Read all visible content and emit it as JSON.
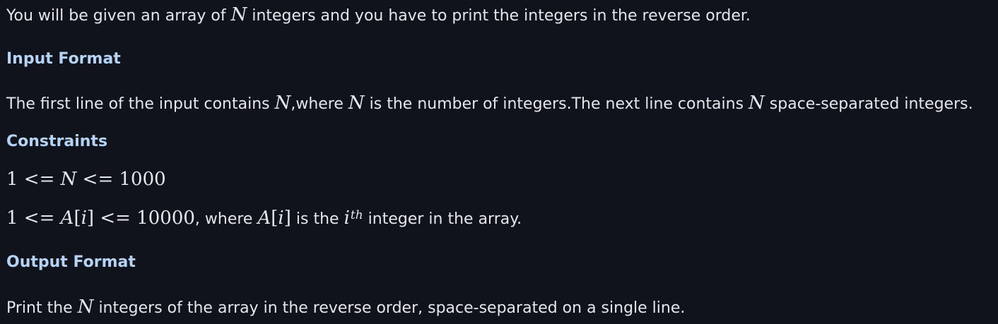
{
  "intro": {
    "before": "You will be given an array of ",
    "var_n": "N",
    "after": " integers and you have to print the integers in the reverse order."
  },
  "input_format": {
    "heading": "Input Format",
    "part1": "The first line of the input contains ",
    "var1": "N",
    "part2": ",where ",
    "var2": "N",
    "part3": " is the number of integers.The next line contains ",
    "var3": "N",
    "part4": " space-separated integers."
  },
  "constraints": {
    "heading": "Constraints",
    "line1": {
      "lower": "1",
      "op1": " <= ",
      "var": "N",
      "op2": " <= ",
      "upper": "1000"
    },
    "line2": {
      "lower": "1",
      "op1": " <= ",
      "var_a": "A",
      "bracket_open": "[",
      "var_i": "i",
      "bracket_close": "]",
      "op2": " <= ",
      "upper": "10000",
      "text1": ", where ",
      "var_a2": "A",
      "bracket_open2": "[",
      "var_i2": "i",
      "bracket_close2": "]",
      "text2": " is the ",
      "var_i3": "i",
      "superscript": "th",
      "text3": " integer in the array."
    }
  },
  "output_format": {
    "heading": "Output Format",
    "part1": "Print the ",
    "var": "N",
    "part2": " integers of the array in the reverse order, space-separated on a single line."
  }
}
